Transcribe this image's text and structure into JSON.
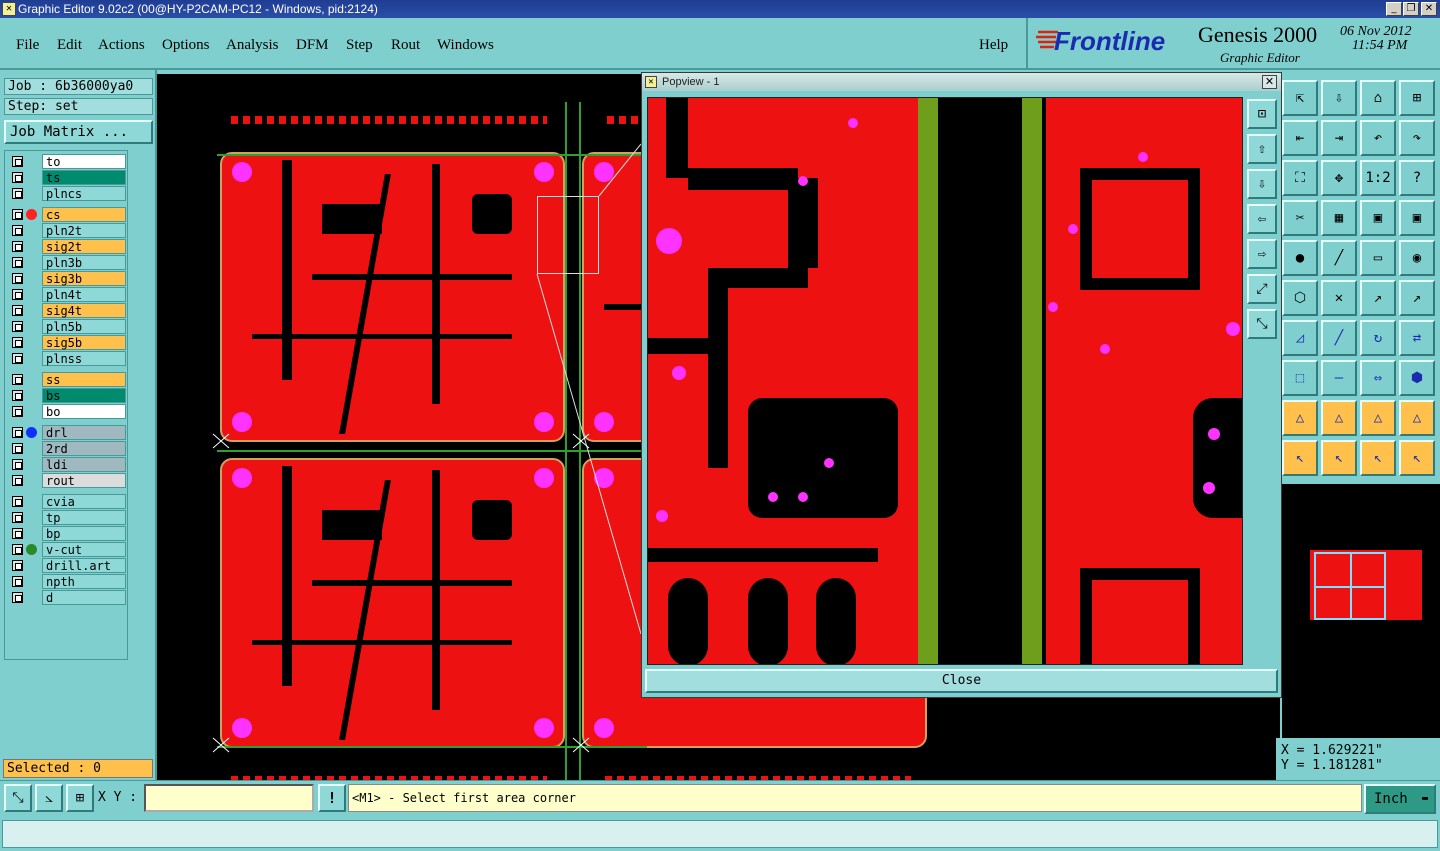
{
  "window": {
    "title": "Graphic Editor 9.02c2 (00@HY-P2CAM-PC12 - Windows, pid:2124)"
  },
  "menu": {
    "items": [
      "File",
      "Edit",
      "Actions",
      "Options",
      "Analysis",
      "DFM",
      "Step",
      "Rout",
      "Windows"
    ],
    "help": "Help"
  },
  "brand": {
    "logo": "Frontline",
    "product": "Genesis 2000",
    "subtitle": "Graphic Editor",
    "date": "06 Nov 2012",
    "time": "11:54 PM"
  },
  "job": {
    "job_label": "Job : 6b36000ya0",
    "step_label": "Step: set",
    "matrix_button": "Job Matrix ..."
  },
  "layers": [
    {
      "name": "to",
      "color": "#ffffff",
      "dot": ""
    },
    {
      "name": "ts",
      "color": "#008a6e",
      "dot": ""
    },
    {
      "name": "plncs",
      "color": "#8fd8d8",
      "dot": ""
    },
    {
      "name": "cs",
      "color": "#ffc04c",
      "dot": "#ff2222"
    },
    {
      "name": "pln2t",
      "color": "#8fd8d8",
      "dot": ""
    },
    {
      "name": "sig2t",
      "color": "#ffc04c",
      "dot": ""
    },
    {
      "name": "pln3b",
      "color": "#8fd8d8",
      "dot": ""
    },
    {
      "name": "sig3b",
      "color": "#ffc04c",
      "dot": ""
    },
    {
      "name": "pln4t",
      "color": "#8fd8d8",
      "dot": ""
    },
    {
      "name": "sig4t",
      "color": "#ffc04c",
      "dot": ""
    },
    {
      "name": "pln5b",
      "color": "#8fd8d8",
      "dot": ""
    },
    {
      "name": "sig5b",
      "color": "#ffc04c",
      "dot": ""
    },
    {
      "name": "plnss",
      "color": "#8fd8d8",
      "dot": ""
    },
    {
      "name": "ss",
      "color": "#ffc04c",
      "dot": ""
    },
    {
      "name": "bs",
      "color": "#008a6e",
      "dot": ""
    },
    {
      "name": "bo",
      "color": "#ffffff",
      "dot": ""
    },
    {
      "name": "drl",
      "color": "#a0b8c0",
      "dot": "#1030ff"
    },
    {
      "name": "2rd",
      "color": "#a0b8c0",
      "dot": ""
    },
    {
      "name": "ldi",
      "color": "#a0b8c0",
      "dot": ""
    },
    {
      "name": "rout",
      "color": "#dcdcdc",
      "dot": ""
    },
    {
      "name": "cvia",
      "color": "#8fd8d8",
      "dot": ""
    },
    {
      "name": "tp",
      "color": "#8fd8d8",
      "dot": ""
    },
    {
      "name": "bp",
      "color": "#8fd8d8",
      "dot": ""
    },
    {
      "name": "v-cut",
      "color": "#8fd8d8",
      "dot": "#2a8a2a"
    },
    {
      "name": "drill.art",
      "color": "#8fd8d8",
      "dot": ""
    },
    {
      "name": "npth",
      "color": "#8fd8d8",
      "dot": ""
    },
    {
      "name": "d",
      "color": "#8fd8d8",
      "dot": ""
    }
  ],
  "selected": "Selected : 0",
  "popview": {
    "title": "Popview - 1",
    "close_label": "Close"
  },
  "coords": {
    "x": "X =  1.629221\"",
    "y": "Y =  1.181281\""
  },
  "status": {
    "xy_label": "X Y :",
    "xy_value": "",
    "warn": "!",
    "message": "<M1> - Select first area corner",
    "units": "Inch"
  },
  "tools": [
    "move-icon",
    "save-icon",
    "home-icon",
    "frame-icon",
    "left-icon",
    "right-icon",
    "undo-icon",
    "redo-icon",
    "fit-icon",
    "center-icon",
    "ratio-icon",
    "help-icon",
    "cross-icon",
    "grid-icon",
    "layers-icon",
    "layers2-icon",
    "pad-icon",
    "draw-icon",
    "ruler-icon",
    "circle-icon",
    "net-icon",
    "snap-icon",
    "probe-icon",
    "probe2-icon",
    "line-icon",
    "slash-icon",
    "arc-icon",
    "swap-icon",
    "feature-icon",
    "minus-icon",
    "dim-icon",
    "shape-icon",
    "tri-icon",
    "tri2-icon",
    "tri3-icon",
    "tri4-icon",
    "select-icon",
    "select2-icon",
    "select3-icon",
    "select4-icon"
  ],
  "tool_glyphs": [
    "⇱",
    "⇩",
    "⌂",
    "⊞",
    "⇤",
    "⇥",
    "↶",
    "↷",
    "⛶",
    "✥",
    "1:2",
    "?",
    "✂",
    "▦",
    "▣",
    "▣",
    "●",
    "╱",
    "▭",
    "◉",
    "⬡",
    "✕",
    "↗",
    "↗",
    "◿",
    "╱",
    "↻",
    "⇄",
    "⬚",
    "—",
    "⇔",
    "⬢",
    "△",
    "△",
    "△",
    "△",
    "↖",
    "↖",
    "↖",
    "↖"
  ],
  "pv_tools": [
    "zoom-fit-icon",
    "zoom-up-icon",
    "zoom-down-icon",
    "pan-left-icon",
    "pan-right-icon",
    "expand-icon",
    "contract-icon"
  ],
  "pv_glyphs": [
    "⊡",
    "⇧",
    "⇩",
    "⇦",
    "⇨",
    "⤢",
    "⤡"
  ],
  "bottom_tools": [
    "zoom-area-icon",
    "measure-icon",
    "grid-toggle-icon"
  ],
  "bottom_glyphs": [
    "⤡",
    "⦣",
    "⊞"
  ]
}
